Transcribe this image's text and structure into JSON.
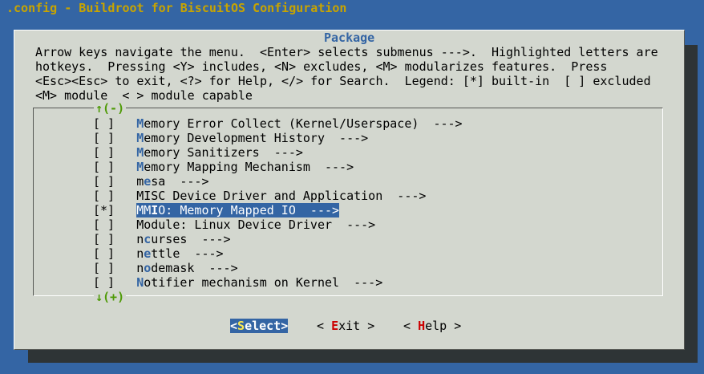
{
  "window": {
    "title": ".config - Buildroot for BiscuitOS Configuration"
  },
  "dialog": {
    "title": "Package",
    "help_lines": [
      "Arrow keys navigate the menu.  <Enter> selects submenus --->.  Highlighted letters are",
      "hotkeys.  Pressing <Y> includes, <N> excludes, <M> modularizes features.  Press",
      "<Esc><Esc> to exit, <?> for Help, </> for Search.  Legend: [*] built-in  [ ] excluded",
      "<M> module  < > module capable"
    ],
    "scroll_up": "↑(-)",
    "scroll_down": "↓(+)"
  },
  "menu": {
    "items": [
      {
        "check": "[ ]",
        "hotkey": "M",
        "rest": "emory Error Collect (Kernel/Userspace)",
        "suffix": "  --->"
      },
      {
        "check": "[ ]",
        "hotkey": "M",
        "rest": "emory Development History",
        "suffix": "  --->"
      },
      {
        "check": "[ ]",
        "hotkey": "M",
        "rest": "emory Sanitizers",
        "suffix": "  --->"
      },
      {
        "check": "[ ]",
        "hotkey": "M",
        "rest": "emory Mapping Mechanism",
        "suffix": "  --->"
      },
      {
        "check": "[ ]",
        "pre": "m",
        "hotkey": "e",
        "rest": "sa",
        "suffix": "  --->"
      },
      {
        "check": "[ ]",
        "pre": "",
        "hotkey": "",
        "rest": "MISC Device Driver and Application",
        "suffix": "  --->"
      },
      {
        "check": "[*]",
        "pre": "MM",
        "hotkey": "I",
        "rest": "O: Memory Mapped IO",
        "suffix": "  --->",
        "selected": true
      },
      {
        "check": "[ ]",
        "pre": "",
        "hotkey": "",
        "rest": "Module: Linux Device Driver",
        "suffix": "  --->"
      },
      {
        "check": "[ ]",
        "pre": "n",
        "hotkey": "c",
        "rest": "urses",
        "suffix": "  --->"
      },
      {
        "check": "[ ]",
        "pre": "n",
        "hotkey": "e",
        "rest": "ttle",
        "suffix": "  --->"
      },
      {
        "check": "[ ]",
        "pre": "n",
        "hotkey": "o",
        "rest": "demask",
        "suffix": "  --->"
      },
      {
        "check": "[ ]",
        "pre": "",
        "hotkey": "N",
        "rest": "otifier mechanism on Kernel",
        "suffix": "  --->"
      }
    ]
  },
  "buttons": {
    "select": {
      "open": "<",
      "hotkey": "S",
      "rest": "elect",
      "close": ">"
    },
    "exit": {
      "open": "< ",
      "hotkey": "E",
      "rest": "xit",
      "close": " >"
    },
    "help": {
      "open": "< ",
      "hotkey": "H",
      "rest": "elp",
      "close": " >"
    }
  },
  "colors": {
    "desktop": "#3465a4",
    "dialog_bg": "#d3d7cf",
    "title_fg": "#c8a400",
    "accent": "#3465a4",
    "hotkey_button": "#cc0000",
    "scroll_arrow": "#4e9a06"
  }
}
